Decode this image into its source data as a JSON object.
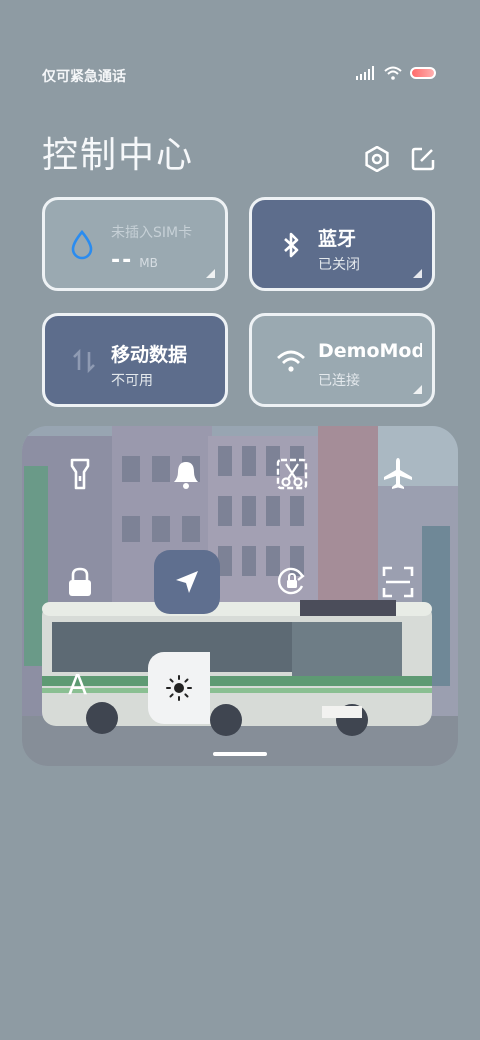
{
  "status": {
    "carrier_text": "仅可紧急通话"
  },
  "header": {
    "title": "控制中心",
    "settings_icon": "gear-hexagon-icon",
    "edit_icon": "edit-icon"
  },
  "tiles": {
    "sim": {
      "line1": "未插入SIM卡",
      "dash": "--",
      "unit": "MB",
      "icon": "water-drop-icon"
    },
    "bluetooth": {
      "label": "蓝牙",
      "status": "已关闭",
      "icon": "bluetooth-icon"
    },
    "mobile_data": {
      "label": "移动数据",
      "status": "不可用",
      "icon": "data-arrows-icon"
    },
    "wifi": {
      "label": "DemoMode",
      "status": "已连接",
      "icon": "wifi-icon"
    }
  },
  "quick_toggles": [
    {
      "name": "flashlight",
      "icon": "flashlight-icon"
    },
    {
      "name": "notifications",
      "icon": "bell-icon"
    },
    {
      "name": "screenshot",
      "icon": "scissors-icon"
    },
    {
      "name": "airplane",
      "icon": "airplane-icon"
    },
    {
      "name": "lock",
      "icon": "lock-icon"
    },
    {
      "name": "location",
      "icon": "location-arrow-icon",
      "active": true
    },
    {
      "name": "rotation-lock",
      "icon": "rotate-lock-icon"
    },
    {
      "name": "scanner",
      "icon": "scan-icon"
    }
  ],
  "font_toggle": {
    "label": "A"
  },
  "colors": {
    "background": "#8e9ba3",
    "tile_active": "#5d6d8c",
    "tile_inactive": "#9aa9b1",
    "accent_blue": "#2a8cf0"
  }
}
